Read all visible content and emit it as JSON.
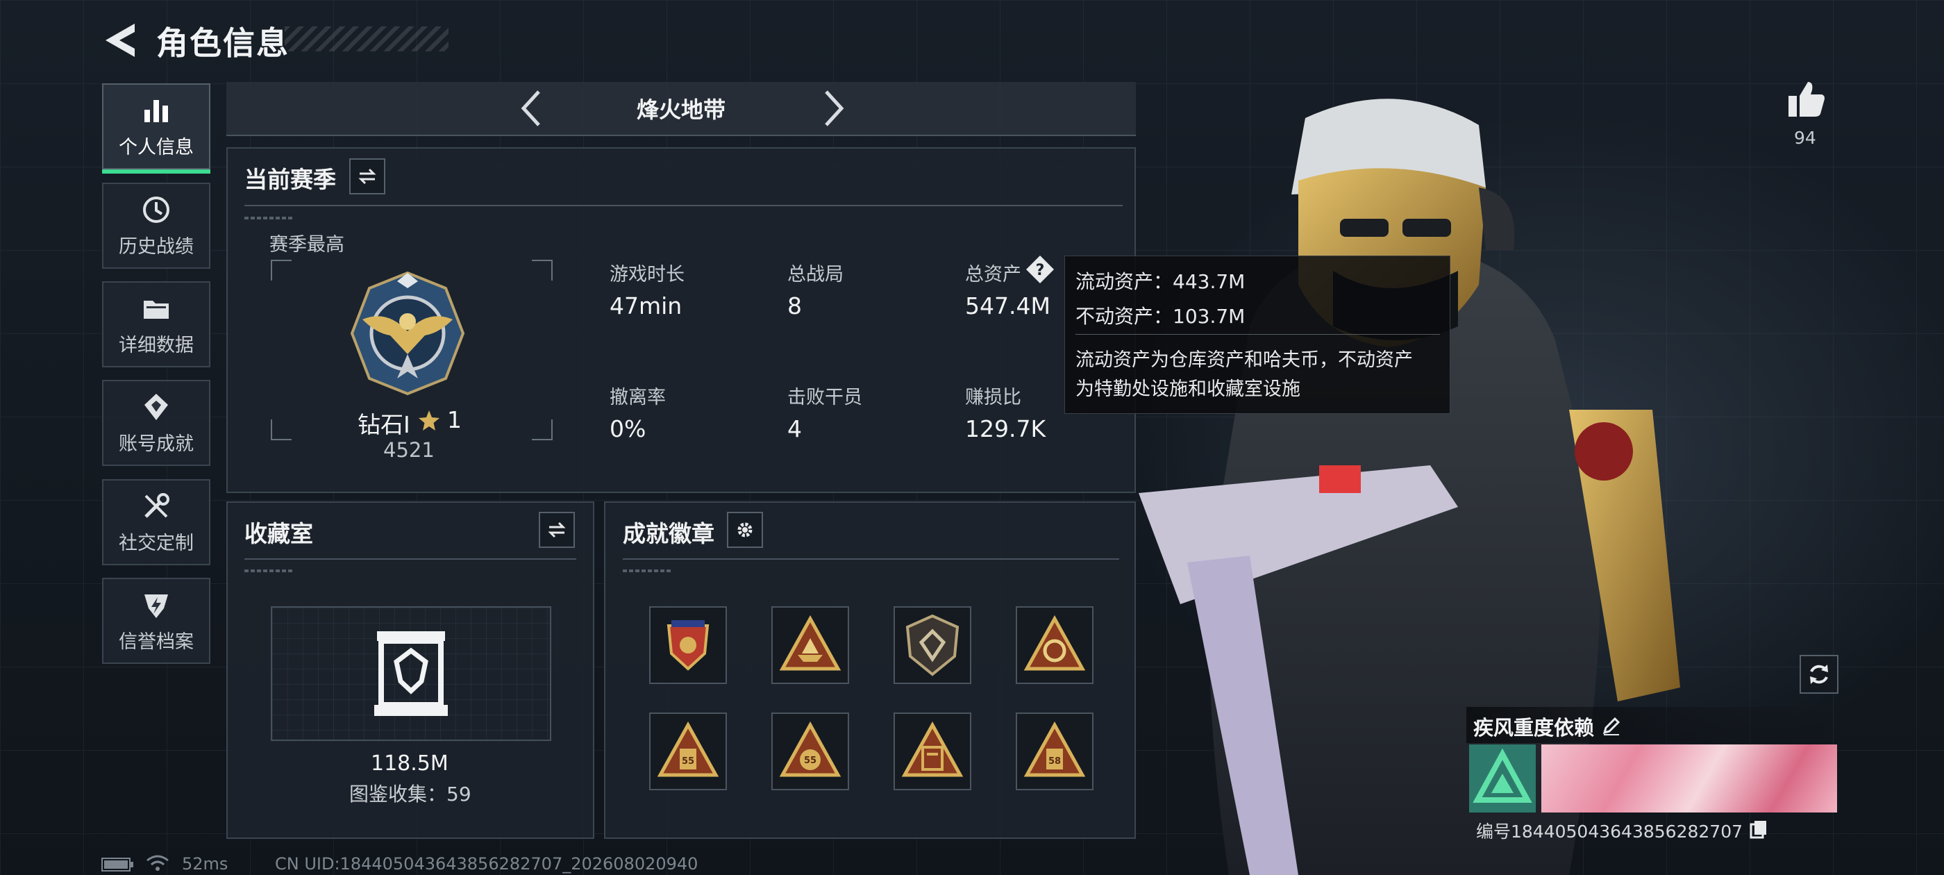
{
  "header": {
    "title": "角色信息"
  },
  "sidebar": {
    "items": [
      {
        "label": "个人信息",
        "icon": "bar-chart-icon",
        "active": true
      },
      {
        "label": "历史战绩",
        "icon": "history-icon",
        "active": false
      },
      {
        "label": "详细数据",
        "icon": "folder-icon",
        "active": false
      },
      {
        "label": "账号成就",
        "icon": "achievement-icon",
        "active": false
      },
      {
        "label": "社交定制",
        "icon": "tools-icon",
        "active": false
      },
      {
        "label": "信誉档案",
        "icon": "shield-bolt-icon",
        "active": false
      }
    ]
  },
  "mode": {
    "label": "烽火地带"
  },
  "season": {
    "title": "当前赛季",
    "best_label": "赛季最高",
    "rank_name": "钻石I",
    "rank_stars": "1",
    "rank_score": "4521",
    "stats": [
      {
        "label": "游戏时长",
        "value": "47min"
      },
      {
        "label": "总战局",
        "value": "8"
      },
      {
        "label": "总资产",
        "value": "547.4M"
      },
      {
        "label": "撤离率",
        "value": "0%"
      },
      {
        "label": "击败干员",
        "value": "4"
      },
      {
        "label": "赚损比",
        "value": "129.7K"
      }
    ]
  },
  "tooltip": {
    "liquid": "流动资产：443.7M",
    "fixed": "不动资产：103.7M",
    "desc_line1": "流动资产为仓库资产和哈夫币，不动资产",
    "desc_line2": "为特勤处设施和收藏室设施"
  },
  "collection": {
    "title": "收藏室",
    "value": "118.5M",
    "catalog": "图鉴收集：59"
  },
  "badges": {
    "title": "成就徽章",
    "items": [
      {
        "icon": "red-shield-badge-icon"
      },
      {
        "icon": "triangle-boat-badge-icon"
      },
      {
        "icon": "hex-emblem-badge-icon"
      },
      {
        "icon": "triangle-hands-badge-icon"
      },
      {
        "icon": "triangle-armor-55-badge-icon",
        "text": "55"
      },
      {
        "icon": "triangle-gear-55-badge-icon",
        "text": "55"
      },
      {
        "icon": "triangle-document-badge-icon"
      },
      {
        "icon": "triangle-tag-58-badge-icon",
        "text": "58"
      }
    ]
  },
  "likes": {
    "count": "94"
  },
  "player": {
    "nickname": "疾风重度依赖",
    "uid": "编号18440504364385628​2707"
  },
  "status": {
    "ping": "52ms",
    "cn_uid": "CN UID:18440504364385628​2707_202608020940"
  },
  "colors": {
    "accent_green": "#3ddc92",
    "gold": "#d8b15a"
  }
}
